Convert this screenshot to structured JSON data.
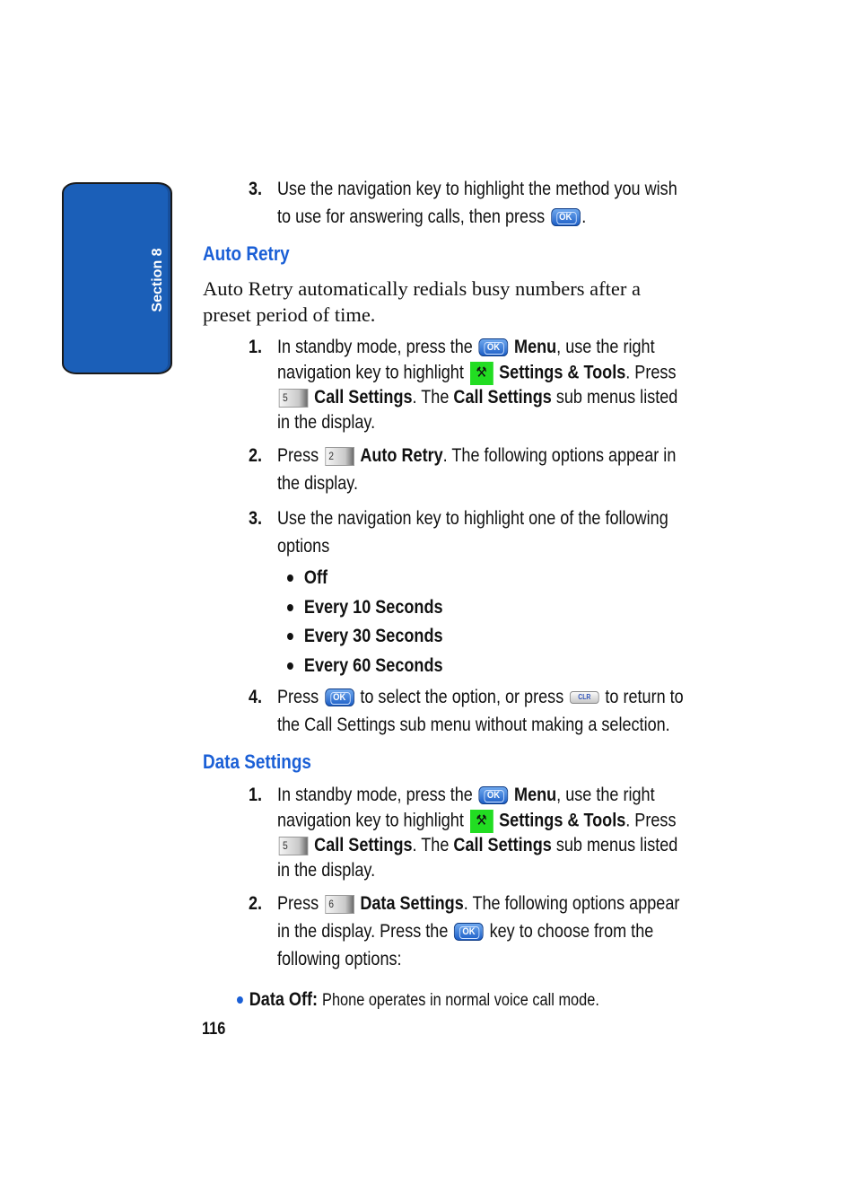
{
  "sidebar_tab": {
    "label": "Section 8",
    "color": "#1b5fb8"
  },
  "intro_step": {
    "number": "3.",
    "line1": "Use the navigation key to highlight the method you wish",
    "line2_pre": "to use for answering calls, then press",
    "line2_post": "."
  },
  "auto_retry": {
    "heading": "Auto Retry",
    "description_line1": "Auto Retry automatically redials busy numbers after a",
    "description_line2": "preset period of time.",
    "steps": [
      {
        "number": "1.",
        "l1_pre": "In standby mode, press the",
        "l1_bold": "Menu",
        "l1_post": ", use the right",
        "l2_pre": "navigation key to highlight",
        "l2_bold": "Settings & Tools",
        "l2_post": ". Press",
        "l3_bold1": "Call Settings",
        "l3_mid": ". The",
        "l3_bold2": "Call Settings",
        "l3_post": "sub menus listed",
        "l4": "in the display."
      },
      {
        "number": "2.",
        "l1_pre": "Press",
        "l1_bold": "Auto Retry",
        "l1_post": ". The following options appear in",
        "l2": "the display."
      },
      {
        "number": "3.",
        "l1": "Use the navigation key to highlight one of the following",
        "l2": "options"
      },
      {
        "number": "4.",
        "l1_pre": "Press",
        "l1_mid": "to select the option, or press",
        "l1_post": "to return to",
        "l2": "the Call Settings sub menu without making a selection."
      }
    ],
    "options": [
      "Off",
      "Every 10 Seconds",
      "Every 30 Seconds",
      "Every 60 Seconds"
    ]
  },
  "data_settings": {
    "heading": "Data Settings",
    "steps": [
      {
        "number": "1.",
        "l1_pre": "In standby mode, press the",
        "l1_bold": "Menu",
        "l1_post": ", use the right",
        "l2_pre": "navigation key to highlight",
        "l2_bold": "Settings & Tools",
        "l2_post": ". Press",
        "l3_bold1": "Call Settings",
        "l3_mid": ". The",
        "l3_bold2": "Call Settings",
        "l3_post": "sub menus listed",
        "l4": "in the display."
      },
      {
        "number": "2.",
        "l1_pre": "Press",
        "l1_bold": "Data Settings",
        "l1_post": ". The following options appear",
        "l2_pre": "in the display. Press the",
        "l2_post": "key to choose from the",
        "l3": "following options:"
      }
    ],
    "options": [
      {
        "label": "Data Off:",
        "description": "Phone operates in normal voice call mode."
      }
    ]
  },
  "keys": {
    "ok": "OK",
    "key5": "5",
    "key2": "2",
    "key6": "6",
    "clr": "CLR",
    "tools_icon": "settings-tools-icon"
  },
  "page_number": "116"
}
